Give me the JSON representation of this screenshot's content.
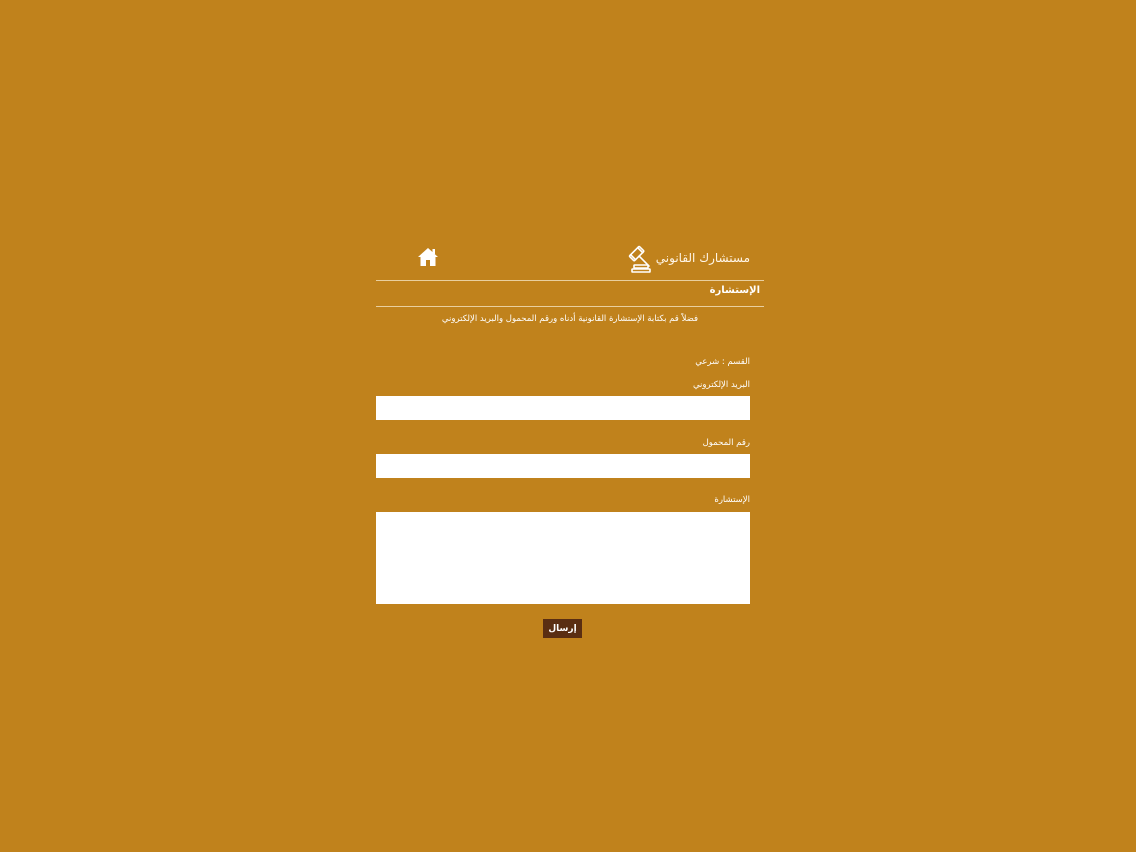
{
  "header": {
    "brand_title": "مستشارك القانوني",
    "brand_icon": "gavel-icon",
    "home_icon": "home-icon"
  },
  "section_title": "الإستشارة",
  "intro_text": "فضلاً قم بكتابة الإستشارة القانونية أدناه ورقم المحمول والبريد الإلكتروني",
  "department": "القسم : شرعي",
  "form": {
    "email_label": "البريد الإلكتروني",
    "email_value": "",
    "mobile_label": "رقم المحمول",
    "mobile_value": "",
    "consultation_label": "الإستشارة",
    "consultation_value": "",
    "submit_label": "إرسال"
  },
  "colors": {
    "background": "#c0821c",
    "button": "#5a2e12",
    "text": "#ffffff"
  }
}
